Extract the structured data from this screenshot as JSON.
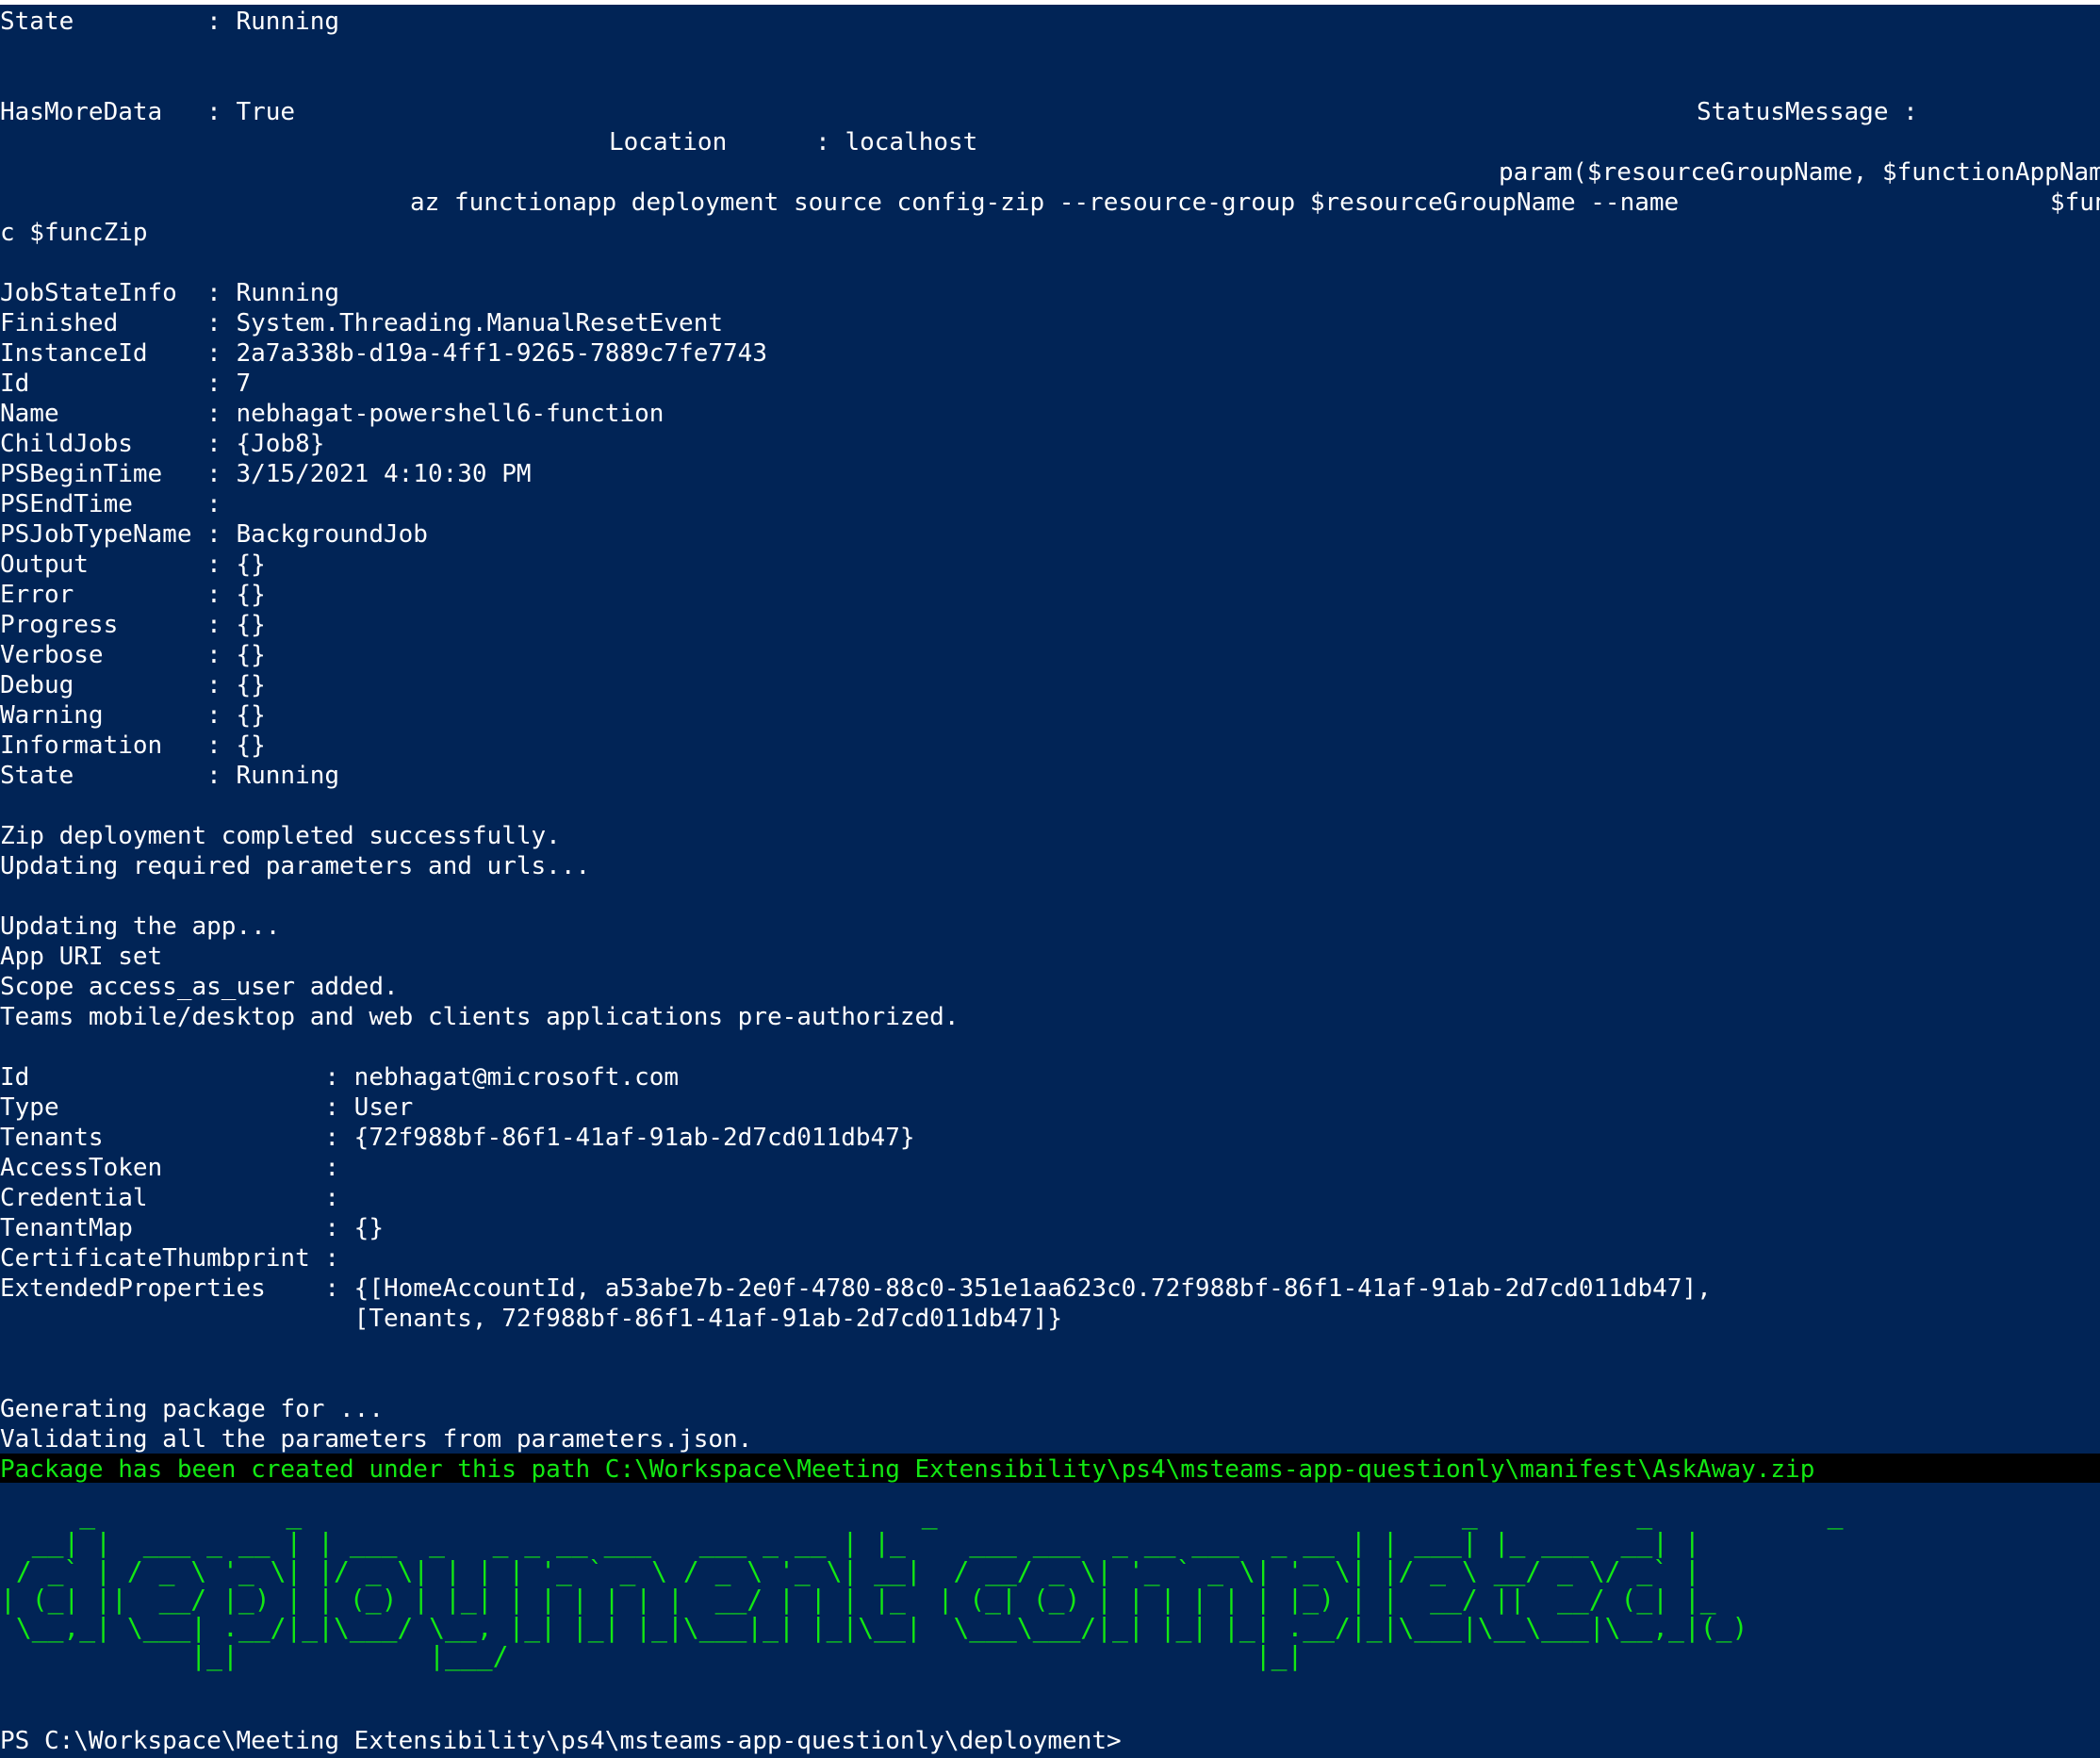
{
  "console": {
    "lines": {
      "l01": "State         : Running",
      "l02": "HasMoreData   : True",
      "l02b": "StatusMessage :",
      "l03": "Location      : localhost",
      "l04": "param($resourceGroupName, $functionAppName,",
      "l05": "az functionapp deployment source config-zip --resource-group $resourceGroupName --name",
      "l05b": "$fun",
      "l06": "c $funcZip",
      "l07": "JobStateInfo  : Running",
      "l08": "Finished      : System.Threading.ManualResetEvent",
      "l09": "InstanceId    : 2a7a338b-d19a-4ff1-9265-7889c7fe7743",
      "l10": "Id            : 7",
      "l11": "Name          : nebhagat-powershell6-function",
      "l12": "ChildJobs     : {Job8}",
      "l13": "PSBeginTime   : 3/15/2021 4:10:30 PM",
      "l14": "PSEndTime     :",
      "l15": "PSJobTypeName : BackgroundJob",
      "l16": "Output        : {}",
      "l17": "Error         : {}",
      "l18": "Progress      : {}",
      "l19": "Verbose       : {}",
      "l20": "Debug         : {}",
      "l21": "Warning       : {}",
      "l22": "Information   : {}",
      "l23": "State         : Running",
      "l24": "Zip deployment completed successfully.",
      "l25": "Updating required parameters and urls...",
      "l26": "Updating the app...",
      "l27": "App URI set",
      "l28": "Scope access_as_user added.",
      "l29": "Teams mobile/desktop and web clients applications pre-authorized.",
      "l30": "Id                    : nebhagat@microsoft.com",
      "l31": "Type                  : User",
      "l32": "Tenants               : {72f988bf-86f1-41af-91ab-2d7cd011db47}",
      "l33": "AccessToken           :",
      "l34": "Credential            :",
      "l35": "TenantMap             : {}",
      "l36": "CertificateThumbprint :",
      "l37": "ExtendedProperties    : {[HomeAccountId, a53abe7b-2e0f-4780-88c0-351e1aa623c0.72f988bf-86f1-41af-91ab-2d7cd011db47],",
      "l38": "                        [Tenants, 72f988bf-86f1-41af-91ab-2d7cd011db47]}",
      "l39": "Generating package for ...",
      "l40": "Validating all the parameters from parameters.json.",
      "l41": "Package has been created under this path C:\\Workspace\\Meeting Extensibility\\ps4\\msteams-app-questionly\\manifest\\AskAway.zip"
    },
    "banner": "     _            _                                       _                                 _          _           _ \n  __| |  ___ _ __ | | ___  _   _ _ __ ___   ___ _ __ | |_    ___ ___  _ __ ___  _ __ | | ___| |_ ___  __| |\n / _` | / _ \\ '_ \\| |/ _ \\| | | | '_ ` _ \\ / _ \\ '_ \\| __|  / __/ _ \\| '_ ` _ \\| '_ \\| |/ _ \\ __/ _ \\/ _` |\n| (_| ||  __/ |_) | | (_) | |_| | | | | | |  __/ | | | |_  | (_| (_) | | | | | | |_) | |  __/ ||  __/ (_| |_\n \\__,_| \\___| .__/|_|\\___/ \\__, |_| |_| |_|\\___|_| |_|\\__|  \\___\\___/|_| |_| |_| .__/|_|\\___|\\__\\___|\\__,_|(_)\n            |_|            |___/                                               |_|",
    "prompt": "PS C:\\Workspace\\Meeting Extensibility\\ps4\\msteams-app-questionly\\deployment>"
  },
  "colors": {
    "background": "#012456",
    "text": "#ffffff",
    "success": "#13e813",
    "band": "#000000"
  }
}
